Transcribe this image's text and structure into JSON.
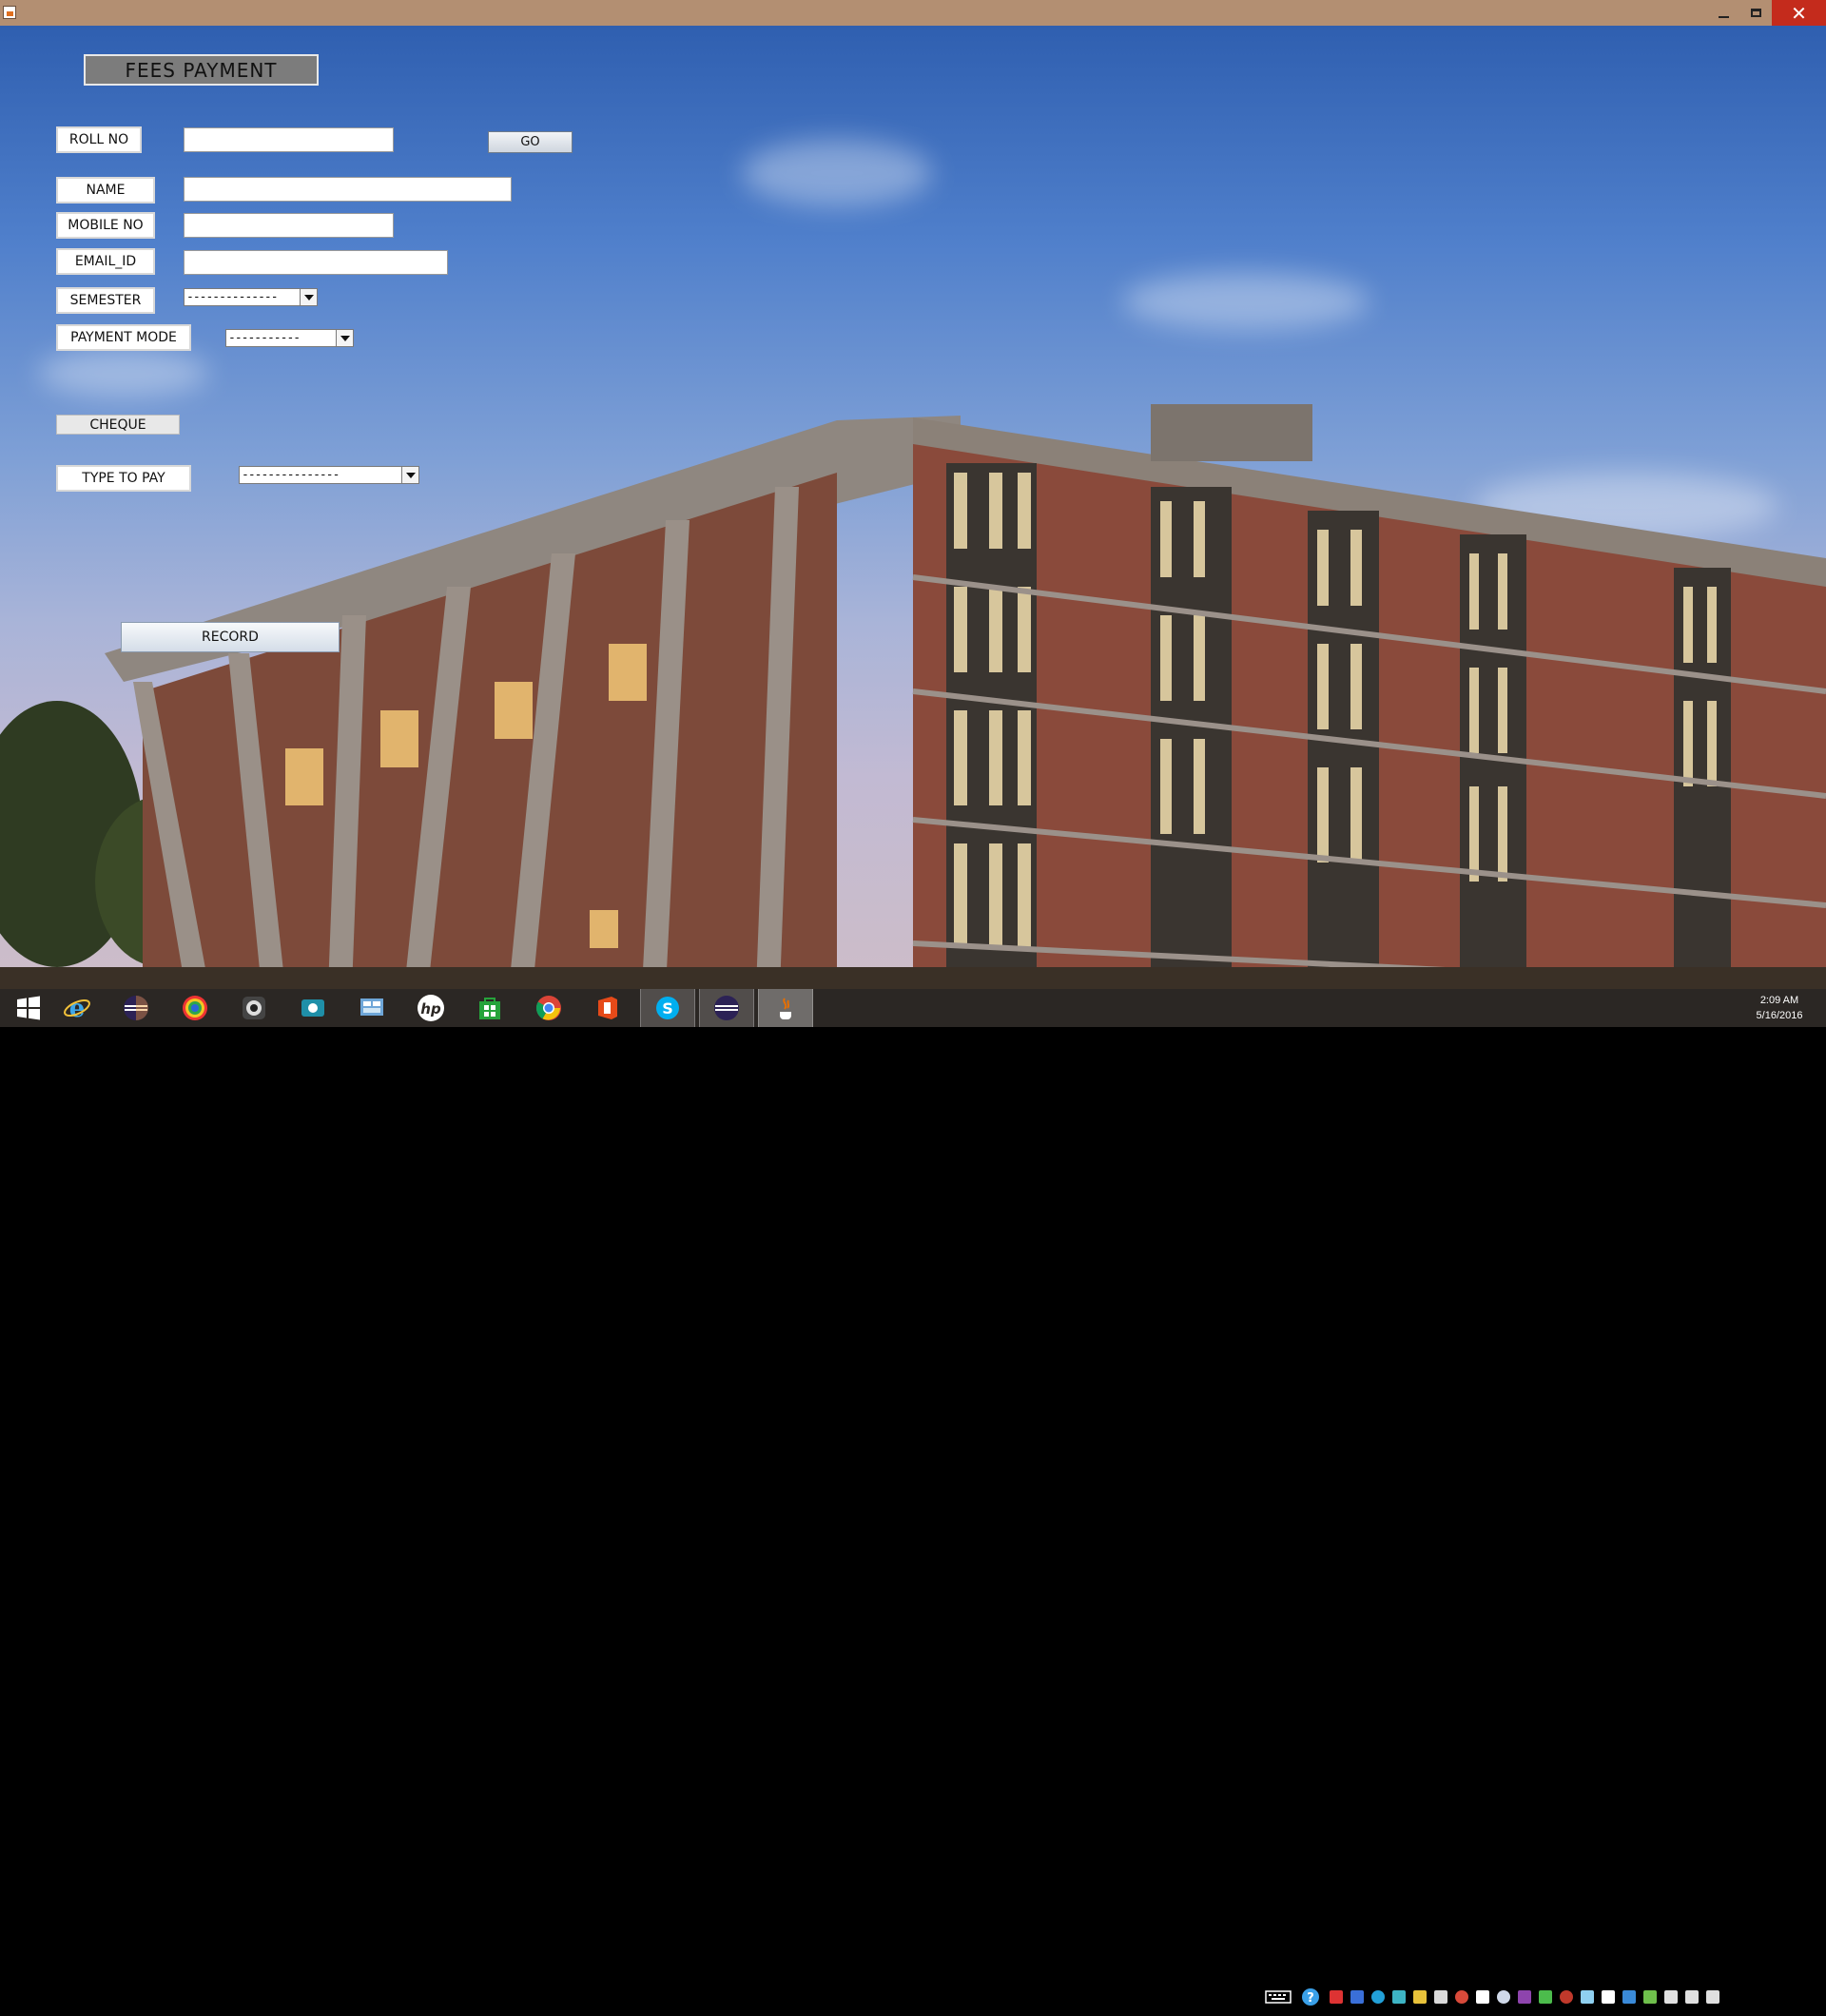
{
  "window": {
    "minimize_label": "",
    "close_label": "✕"
  },
  "form": {
    "title": "FEES  PAYMENT",
    "roll_no_label": "ROLL NO",
    "roll_no_value": "",
    "go_label": "GO",
    "name_label": "NAME",
    "name_value": "",
    "mobile_label": "MOBILE NO",
    "mobile_value": "",
    "email_label": "EMAIL_ID",
    "email_value": "",
    "semester_label": "SEMESTER",
    "semester_selected": "--------------",
    "payment_mode_label": "PAYMENT MODE",
    "payment_mode_selected": "-----------",
    "cheque_label": "CHEQUE",
    "type_to_pay_label": "TYPE TO PAY",
    "type_to_pay_selected": "---------------",
    "record_label": "RECORD"
  },
  "taskbar": {
    "apps": [
      "windows-start",
      "internet-explorer",
      "eclipse",
      "color-app",
      "webcam",
      "camera-app",
      "control-panel",
      "hp",
      "store",
      "chrome",
      "office",
      "skype",
      "eclipse-2",
      "java-app"
    ]
  },
  "clock": {
    "time": "2:09 AM",
    "date": "5/16/2016"
  },
  "colors": {
    "titlebar": "#b38f72",
    "close": "#c42b1c",
    "taskbar": "#2b2724"
  }
}
